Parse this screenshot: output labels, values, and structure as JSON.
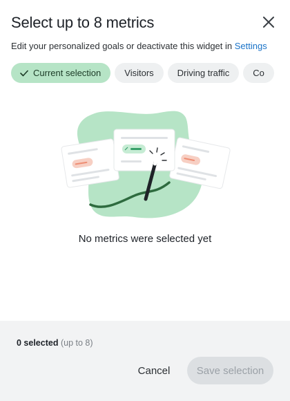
{
  "dialog": {
    "title": "Select up to 8 metrics",
    "subtitle_text": "Edit your personalized goals or deactivate this widget in ",
    "settings_link": "Settings",
    "close_icon": "close-icon"
  },
  "chips": [
    {
      "label": "Current selection",
      "selected": true,
      "icon": "check-icon"
    },
    {
      "label": "Visitors",
      "selected": false
    },
    {
      "label": "Driving traffic",
      "selected": false
    },
    {
      "label": "Co",
      "selected": false
    }
  ],
  "empty_state": {
    "message": "No metrics were selected yet",
    "illustration": "magic-wand-cards-illustration"
  },
  "footer": {
    "selected_count": "0 selected",
    "limit_hint": "(up to 8)",
    "cancel_label": "Cancel",
    "save_label": "Save selection",
    "save_enabled": false
  },
  "colors": {
    "accent_green": "#b6e4c6",
    "link_blue": "#1a73c8",
    "footer_bg": "#f2f3f4",
    "chip_bg": "#eef0f1"
  }
}
